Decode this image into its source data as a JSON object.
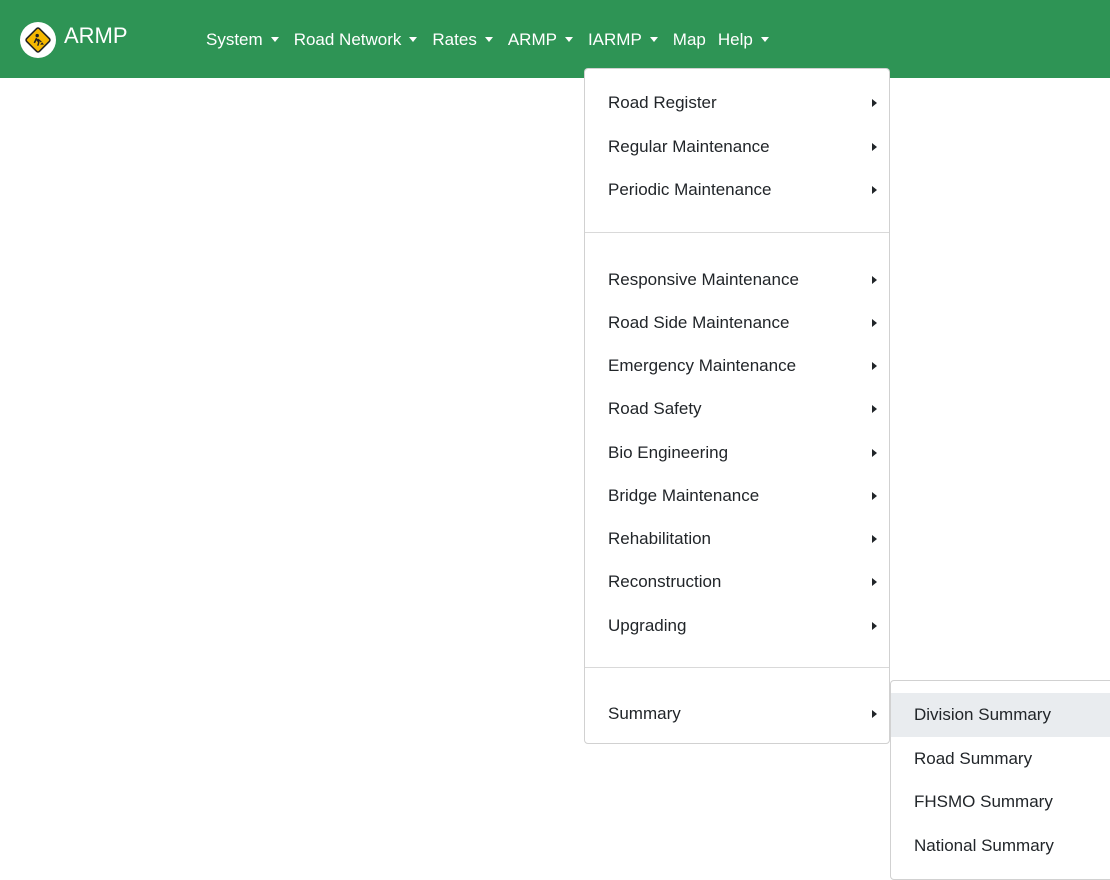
{
  "app": {
    "title": "ARMP",
    "brand_color": "#2e9455",
    "logo_icon": "road-worker-sign-icon"
  },
  "nav": {
    "items": [
      {
        "label": "System",
        "has_dropdown": true
      },
      {
        "label": "Road Network",
        "has_dropdown": true
      },
      {
        "label": "Rates",
        "has_dropdown": true
      },
      {
        "label": "ARMP",
        "has_dropdown": true
      },
      {
        "label": "IARMP",
        "has_dropdown": true
      },
      {
        "label": "Map",
        "has_dropdown": false
      },
      {
        "label": "Help",
        "has_dropdown": true
      }
    ]
  },
  "armp_menu": {
    "items": [
      {
        "label": "Road Register"
      },
      {
        "label": "Regular Maintenance"
      },
      {
        "label": "Periodic Maintenance"
      },
      {
        "label": "Responsive Maintenance"
      },
      {
        "label": "Road Side Maintenance"
      },
      {
        "label": "Emergency Maintenance"
      },
      {
        "label": "Road Safety"
      },
      {
        "label": "Bio Engineering"
      },
      {
        "label": "Bridge Maintenance"
      },
      {
        "label": "Rehabilitation"
      },
      {
        "label": "Reconstruction"
      },
      {
        "label": "Upgrading"
      },
      {
        "label": "Summary"
      }
    ]
  },
  "summary_submenu": {
    "items": [
      {
        "label": "Division Summary",
        "highlighted": true
      },
      {
        "label": "Road Summary",
        "highlighted": false
      },
      {
        "label": "FHSMO Summary",
        "highlighted": false
      },
      {
        "label": "National Summary",
        "highlighted": false
      }
    ]
  }
}
